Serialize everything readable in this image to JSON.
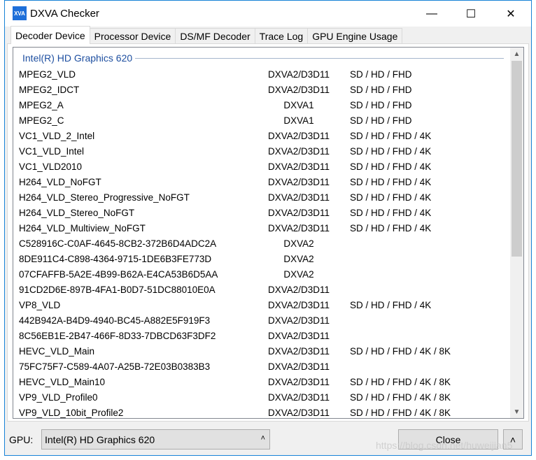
{
  "window": {
    "title": "DXVA Checker",
    "app_icon_text": "XVA",
    "minimize": "—",
    "maximize": "☐",
    "close": "✕"
  },
  "tabs": [
    "Decoder Device",
    "Processor Device",
    "DS/MF Decoder",
    "Trace Log",
    "GPU Engine Usage"
  ],
  "active_tab": 0,
  "group_header": "Intel(R) HD Graphics 620",
  "rows": [
    [
      "MPEG2_VLD",
      "DXVA2/D3D11",
      "SD / HD / FHD"
    ],
    [
      "MPEG2_IDCT",
      "DXVA2/D3D11",
      "SD / HD / FHD"
    ],
    [
      "MPEG2_A",
      "DXVA1",
      "SD / HD / FHD"
    ],
    [
      "MPEG2_C",
      "DXVA1",
      "SD / HD / FHD"
    ],
    [
      "VC1_VLD_2_Intel",
      "DXVA2/D3D11",
      "SD / HD / FHD / 4K"
    ],
    [
      "VC1_VLD_Intel",
      "DXVA2/D3D11",
      "SD / HD / FHD / 4K"
    ],
    [
      "VC1_VLD2010",
      "DXVA2/D3D11",
      "SD / HD / FHD / 4K"
    ],
    [
      "H264_VLD_NoFGT",
      "DXVA2/D3D11",
      "SD / HD / FHD / 4K"
    ],
    [
      "H264_VLD_Stereo_Progressive_NoFGT",
      "DXVA2/D3D11",
      "SD / HD / FHD / 4K"
    ],
    [
      "H264_VLD_Stereo_NoFGT",
      "DXVA2/D3D11",
      "SD / HD / FHD / 4K"
    ],
    [
      "H264_VLD_Multiview_NoFGT",
      "DXVA2/D3D11",
      "SD / HD / FHD / 4K"
    ],
    [
      "C528916C-C0AF-4645-8CB2-372B6D4ADC2A",
      "DXVA2",
      ""
    ],
    [
      "8DE911C4-C898-4364-9715-1DE6B3FE773D",
      "DXVA2",
      ""
    ],
    [
      "07CFAFFB-5A2E-4B99-B62A-E4CA53B6D5AA",
      "DXVA2",
      ""
    ],
    [
      "91CD2D6E-897B-4FA1-B0D7-51DC88010E0A",
      "DXVA2/D3D11",
      ""
    ],
    [
      "VP8_VLD",
      "DXVA2/D3D11",
      "SD / HD / FHD / 4K"
    ],
    [
      "442B942A-B4D9-4940-BC45-A882E5F919F3",
      "DXVA2/D3D11",
      ""
    ],
    [
      "8C56EB1E-2B47-466F-8D33-7DBCD63F3DF2",
      "DXVA2/D3D11",
      ""
    ],
    [
      "HEVC_VLD_Main",
      "DXVA2/D3D11",
      "SD / HD / FHD / 4K / 8K"
    ],
    [
      "75FC75F7-C589-4A07-A25B-72E03B0383B3",
      "DXVA2/D3D11",
      ""
    ],
    [
      "HEVC_VLD_Main10",
      "DXVA2/D3D11",
      "SD / HD / FHD / 4K / 8K"
    ],
    [
      "VP9_VLD_Profile0",
      "DXVA2/D3D11",
      "SD / HD / FHD / 4K / 8K"
    ],
    [
      "VP9_VLD_10bit_Profile2",
      "DXVA2/D3D11",
      "SD / HD / FHD / 4K / 8K"
    ]
  ],
  "scrollbar": {
    "up": "▲",
    "down": "▼"
  },
  "footer": {
    "gpu_label": "GPU:",
    "gpu_value": "Intel(R) HD Graphics 620",
    "combo_arrow": "˄",
    "close_label": "Close",
    "expand_label": "˄"
  },
  "watermark": "https://blog.csdn.net/huweijian5"
}
